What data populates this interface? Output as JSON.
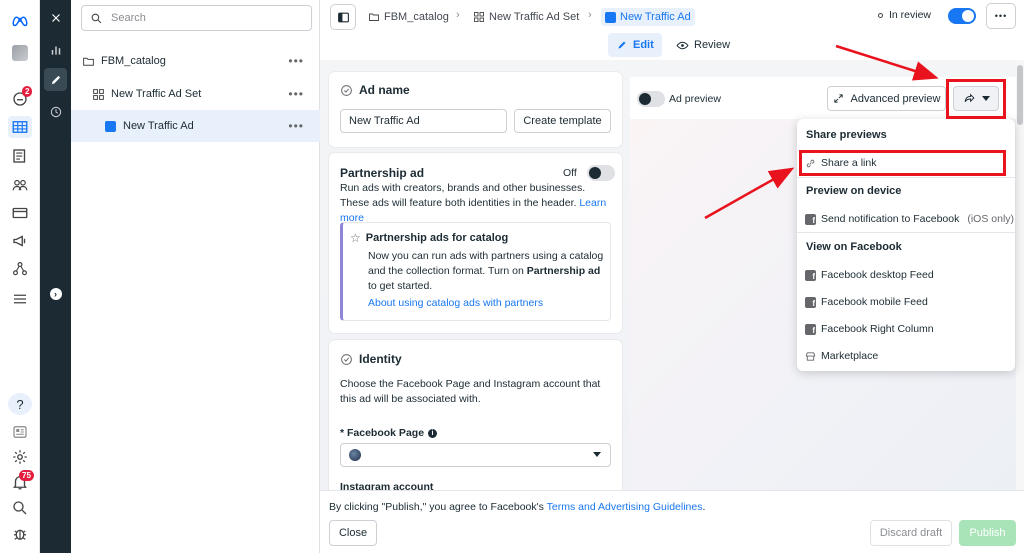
{
  "sidebar": {
    "notifications_badge": "2",
    "alerts_badge": "75"
  },
  "tree": {
    "search_placeholder": "Search",
    "items": [
      {
        "label": "FBM_catalog",
        "more": "•••"
      },
      {
        "label": "New Traffic Ad Set",
        "more": "•••"
      },
      {
        "label": "New Traffic Ad",
        "more": "•••"
      }
    ]
  },
  "topbar": {
    "breadcrumbs": [
      "FBM_catalog",
      "New Traffic Ad Set",
      "New Traffic Ad"
    ],
    "status": "In review",
    "tabs": {
      "edit": "Edit",
      "review": "Review"
    },
    "more": "•••"
  },
  "ad_name": {
    "heading": "Ad name",
    "value": "New Traffic Ad",
    "create_template": "Create template"
  },
  "partnership": {
    "heading": "Partnership ad",
    "toggle_state": "Off",
    "description": "Run ads with creators, brands and other businesses. These ads will feature both identities in the header.",
    "learn_more": "Learn more",
    "catalog_heading": "Partnership ads for catalog",
    "catalog_text_1": "Now you can run ads with partners using a catalog and the collection format. Turn on",
    "catalog_bold": "Partnership ad",
    "catalog_text_2": "to get started.",
    "catalog_link": "About using catalog ads with partners"
  },
  "identity": {
    "heading": "Identity",
    "description": "Choose the Facebook Page and Instagram account that this ad will be associated with.",
    "facebook_page_label": "* Facebook Page",
    "instagram_label": "Instagram account"
  },
  "preview": {
    "toggle_label": "Ad preview",
    "advanced_preview": "Advanced preview"
  },
  "share_menu": {
    "share_previews": "Share previews",
    "share_link": "Share a link",
    "preview_on_device": "Preview on device",
    "send_notification": "Send notification to Facebook",
    "ios_only": "(iOS only)",
    "view_on_facebook": "View on Facebook",
    "placements": [
      "Facebook desktop Feed",
      "Facebook mobile Feed",
      "Facebook Right Column",
      "Marketplace"
    ]
  },
  "footer": {
    "agreement_prefix": "By clicking \"Publish,\" you agree to Facebook's",
    "terms_link": "Terms and Advertising Guidelines",
    "agreement_suffix": ".",
    "close": "Close",
    "discard": "Discard draft",
    "publish": "Publish"
  },
  "colors": {
    "accent": "#1877f2",
    "dark_rail": "#1c2b33",
    "annotation_red": "#e8131d"
  }
}
